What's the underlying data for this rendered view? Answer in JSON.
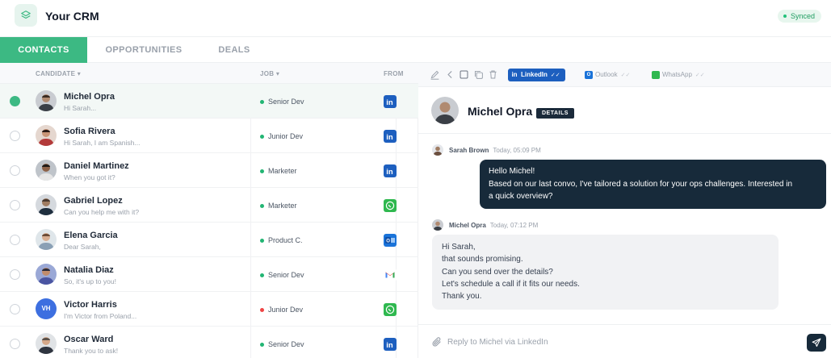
{
  "app": {
    "title": "Your CRM",
    "status": "Synced"
  },
  "tabs": [
    {
      "label": "CONTACTS",
      "active": true
    },
    {
      "label": "OPPORTUNITIES",
      "active": false
    },
    {
      "label": "DEALS",
      "active": false
    }
  ],
  "table": {
    "columns": {
      "candidate": "CANDIDATE",
      "job": "JOB",
      "from": "FROM"
    },
    "rows": [
      {
        "name": "Michel Opra",
        "message": "Hi Sarah...",
        "job": "Senior Dev",
        "job_status": "green",
        "source": "linkedin",
        "selected": true,
        "avatar": "photo"
      },
      {
        "name": "Sofia Rivera",
        "message": "Hi Sarah, I am Spanish...",
        "job": "Junior Dev",
        "job_status": "green",
        "source": "linkedin",
        "selected": false,
        "avatar": "photo"
      },
      {
        "name": "Daniel Martinez",
        "message": "When you got it?",
        "job": "Marketer",
        "job_status": "green",
        "source": "linkedin",
        "selected": false,
        "avatar": "photo"
      },
      {
        "name": "Gabriel Lopez",
        "message": "Can you help me with it?",
        "job": "Marketer",
        "job_status": "green",
        "source": "whatsapp",
        "selected": false,
        "avatar": "photo"
      },
      {
        "name": "Elena Garcia",
        "message": "Dear Sarah,",
        "job": "Product C.",
        "job_status": "green",
        "source": "outlook",
        "selected": false,
        "avatar": "photo"
      },
      {
        "name": "Natalia Diaz",
        "message": "So, it's up to you!",
        "job": "Senior Dev",
        "job_status": "green",
        "source": "gmail",
        "selected": false,
        "avatar": "photo"
      },
      {
        "name": "Victor Harris",
        "message": "I'm Victor from Poland...",
        "job": "Junior Dev",
        "job_status": "red",
        "source": "whatsapp",
        "selected": false,
        "avatar": "initials",
        "initials": "VH"
      },
      {
        "name": "Oscar Ward",
        "message": "Thank you to ask!",
        "job": "Senior Dev",
        "job_status": "green",
        "source": "linkedin",
        "selected": false,
        "avatar": "photo"
      }
    ]
  },
  "conversation": {
    "channels": [
      {
        "label": "LinkedIn",
        "active": true
      },
      {
        "label": "Outlook",
        "active": false
      },
      {
        "label": "WhatsApp",
        "active": false
      }
    ],
    "contact_name": "Michel Opra",
    "details_label": "DETAILS",
    "messages": [
      {
        "author": "Sarah Brown",
        "time": "Today, 05:09 PM",
        "direction": "out",
        "lines": [
          "Hello Michel!",
          "Based on our last convo, I've tailored a solution for your ops challenges. Interested in",
          "a quick overview?"
        ]
      },
      {
        "author": "Michel Opra",
        "time": "Today, 07:12 PM",
        "direction": "in",
        "lines": [
          "Hi Sarah,",
          "that sounds promising.",
          "Can you send over the details?",
          "Let's schedule a call if it fits our needs.",
          "Thank you."
        ]
      }
    ],
    "reply_placeholder": "Reply to Michel via LinkedIn"
  },
  "colors": {
    "accent": "#3cb983",
    "linkedin": "#1d5fbf",
    "whatsapp": "#2fb84f",
    "outlook": "#1a73d9",
    "dark_bubble": "#172a3a"
  }
}
